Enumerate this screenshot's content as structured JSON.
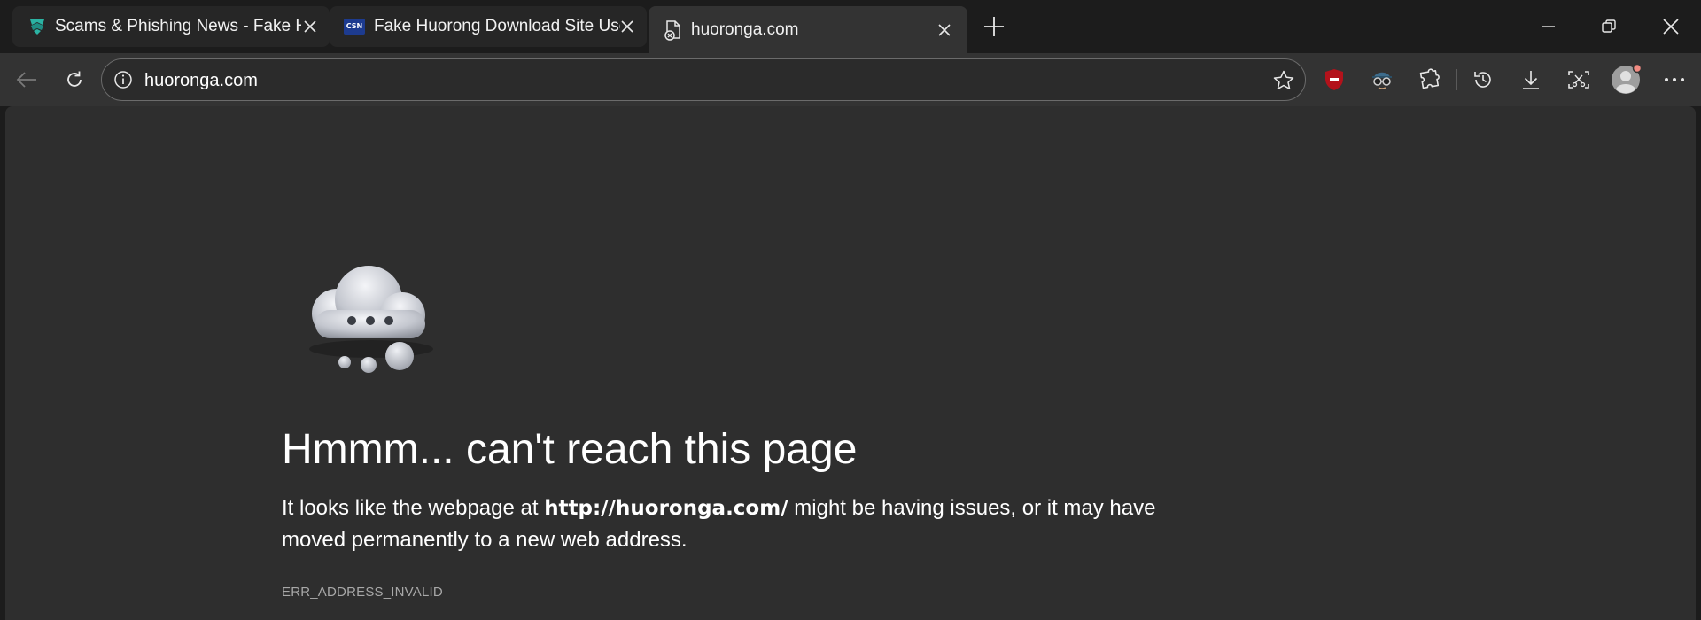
{
  "tabs": [
    {
      "title": "Scams & Phishing News - Fake Huorong",
      "favicon": "shield-logo-icon",
      "state": "inactive"
    },
    {
      "title": "Fake Huorong Download Site Used",
      "favicon": "csn-logo-icon",
      "favicon_text": "CSN",
      "state": "inactive"
    },
    {
      "title": "huoronga.com",
      "favicon": "broken-page-icon",
      "state": "active"
    }
  ],
  "address_bar": {
    "url": "huoronga.com"
  },
  "error_page": {
    "heading": "Hmmm... can't reach this page",
    "desc_before": "It looks like the webpage at ",
    "desc_url": "http://huoronga.com/",
    "desc_after": " might be having issues, or it may have moved permanently to a new web address.",
    "error_code": "ERR_ADDRESS_INVALID"
  },
  "colors": {
    "tab_strip": "#1c1c1c",
    "active_tab": "#333333",
    "content_bg": "#2e2e2e",
    "adblock_red": "#b3121b",
    "profile_badge": "#f28b82"
  }
}
